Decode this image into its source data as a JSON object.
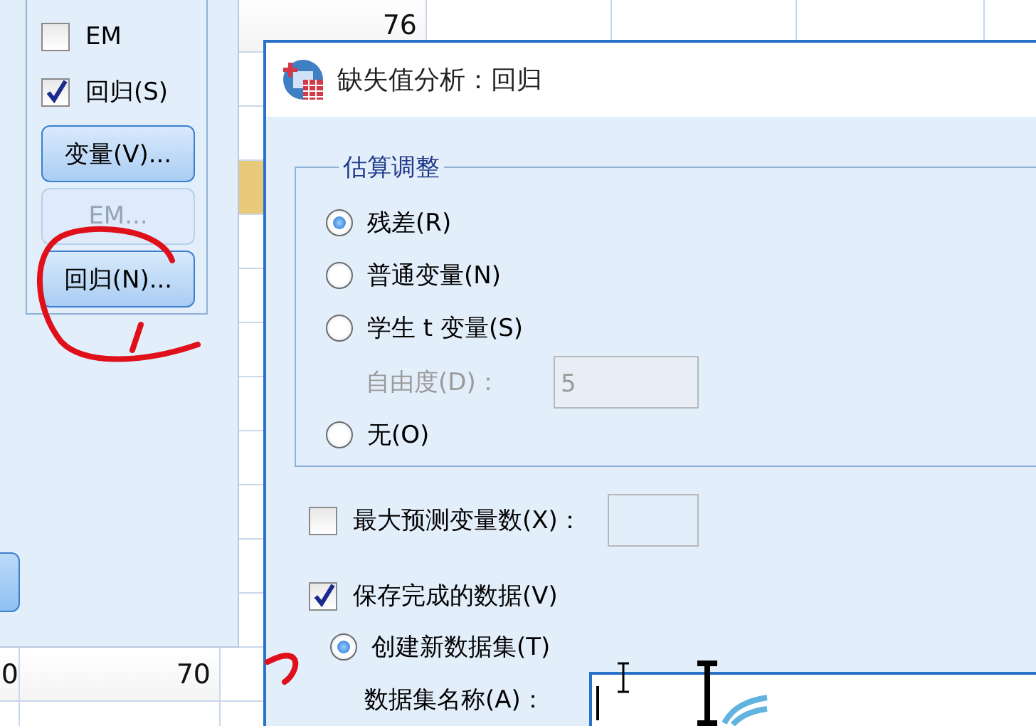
{
  "spreadsheet": {
    "cells": [
      {
        "text": "76",
        "highlighted": false
      },
      {
        "highlighted": true
      },
      {
        "text": "0",
        "highlighted": false
      },
      {
        "text": "70",
        "highlighted": false
      }
    ]
  },
  "side_dialog": {
    "methods": [
      {
        "label": "EM",
        "checked": false
      },
      {
        "label": "回归(S)",
        "checked": true
      }
    ],
    "buttons": [
      {
        "label": "变量(V)...",
        "disabled": false
      },
      {
        "label": "EM...",
        "disabled": true
      },
      {
        "label": "回归(N)...",
        "disabled": false
      }
    ],
    "partial_button": {
      "kind": "button"
    }
  },
  "dialog": {
    "title": "缺失值分析：回归",
    "estimation_adjustment": {
      "title": "估算调整",
      "options": [
        {
          "label": "残差(R)",
          "selected": true
        },
        {
          "label": "普通变量(N)",
          "selected": false
        },
        {
          "label": "学生 t 变量(S)",
          "selected": false,
          "sub": {
            "label": "自由度(D)：",
            "value": "5",
            "disabled": true
          }
        },
        {
          "label": "无(O)",
          "selected": false
        }
      ]
    },
    "max_predictors": {
      "label": "最大预测变量数(X)：",
      "checked": false
    },
    "save_completed": {
      "label": "保存完成的数据(V)",
      "checked": true
    },
    "create_dataset": {
      "label": "创建新数据集(T)",
      "selected": true
    },
    "dataset_name": {
      "label": "数据集名称(A)："
    }
  },
  "overlays": [
    {
      "kind": "circle"
    },
    {
      "kind": "hook"
    },
    {
      "kind": "ibeam"
    },
    {
      "kind": "ibeam-large"
    },
    {
      "kind": "busy"
    }
  ]
}
